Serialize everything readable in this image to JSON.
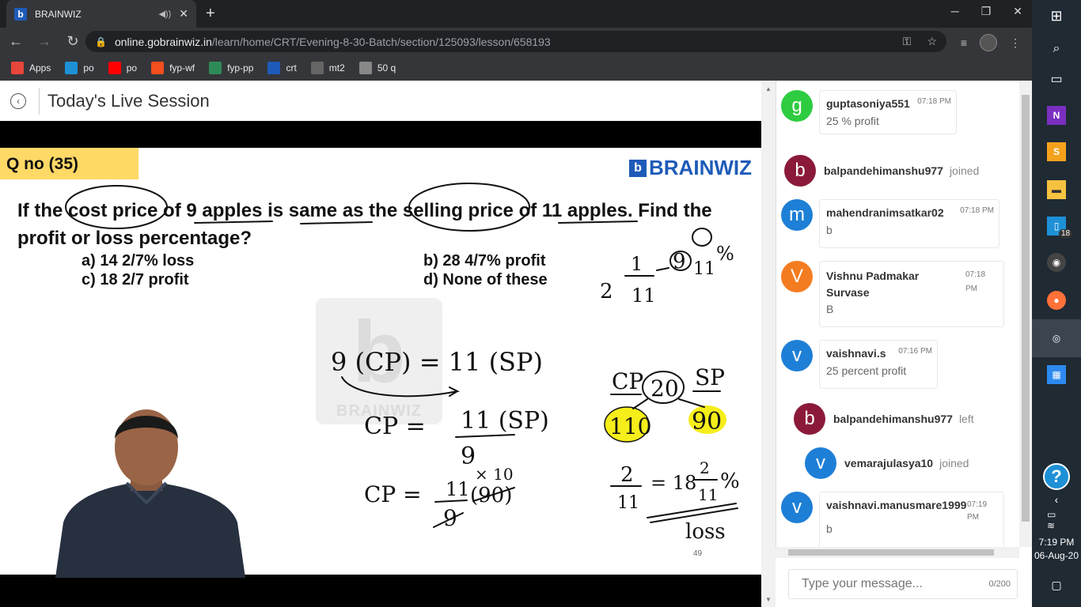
{
  "browser": {
    "tab_title": "BRAINWIZ",
    "url_host": "online.gobrainwiz.in",
    "url_path": "/learn/home/CRT/Evening-8-30-Batch/section/125093/lesson/658193",
    "bookmarks": [
      {
        "label": "Apps",
        "icon": "apps-grid-icon",
        "color": "#e8453c"
      },
      {
        "label": "po",
        "icon": "edge-icon",
        "color": "#1e90d6"
      },
      {
        "label": "po",
        "icon": "youtube-icon",
        "color": "#ff0000"
      },
      {
        "label": "fyp-wf",
        "icon": "figma-icon",
        "color": "#f24e1e"
      },
      {
        "label": "fyp-pp",
        "icon": "chart-icon",
        "color": "#2e8b57"
      },
      {
        "label": "crt",
        "icon": "brainwiz-icon",
        "color": "#1e5bb8"
      },
      {
        "label": "mt2",
        "icon": "cc-icon",
        "color": "#666666"
      },
      {
        "label": "50 q",
        "icon": "globe-icon",
        "color": "#888888"
      }
    ]
  },
  "page": {
    "title": "Today's Live Session"
  },
  "slide": {
    "qno": "Q no (35)",
    "brand": "BRAINWIZ",
    "question": "If the cost price of 9 apples is same as the selling price of 11 apples. Find the profit or loss percentage?",
    "options": {
      "a": "a)   14 2/7% loss",
      "b": "b) 28  4/7% profit",
      "c": "c)   18 2/7 profit",
      "d": "d) None of these"
    },
    "watermark": "BRAINWIZ",
    "page_number": "49"
  },
  "handwriting": {
    "eq1": "9 (CP) = 11 (SP)",
    "eq2_lhs": "CP  =",
    "eq2_num": "11 (SP)",
    "eq2_den": "9",
    "eq3_lhs": "CP  =",
    "eq3_num": "11",
    "eq3_den": "9",
    "eq3_mult": "× 10",
    "eq3_paren": "(90)",
    "cp_label": "CP",
    "sp_label": "SP",
    "diff": "20",
    "cp_val": "110",
    "sp_val": "90",
    "frac_top": "2",
    "frac_bot": "11",
    "result": "= 18",
    "result_frac_top": "2",
    "result_frac_bot": "11",
    "percent": "%",
    "loss": "loss",
    "top_note_2": "2",
    "top_note_1": "1",
    "top_note_11": "11",
    "top_note_9": "9",
    "top_note_pct": "%"
  },
  "chat": {
    "messages": [
      {
        "type": "msg",
        "initial": "g",
        "color": "#2ecc40",
        "user": "guptasoniya551",
        "time": "07:18 PM",
        "text": "25 % profit"
      },
      {
        "type": "event",
        "initial": "b",
        "color": "#8b1a3a",
        "user": "balpandehimanshu977",
        "state": "joined"
      },
      {
        "type": "msg",
        "initial": "m",
        "color": "#1e7fd6",
        "user": "mahendranimsatkar02",
        "time": "07:18 PM",
        "text": "b"
      },
      {
        "type": "msg",
        "initial": "V",
        "color": "#f47c20",
        "user": "Vishnu Padmakar Survase",
        "time": "07:18 PM",
        "text": "B"
      },
      {
        "type": "msg",
        "initial": "v",
        "color": "#1e7fd6",
        "user": "vaishnavi.s",
        "time": "07:16 PM",
        "text": "25 percent profit"
      },
      {
        "type": "event",
        "initial": "b",
        "color": "#8b1a3a",
        "user": "balpandehimanshu977",
        "state": "left"
      },
      {
        "type": "event",
        "initial": "v",
        "color": "#1e7fd6",
        "user": "vemarajulasya10",
        "state": "joined"
      },
      {
        "type": "msg",
        "initial": "v",
        "color": "#1e7fd6",
        "user": "vaishnavi.manusmare1999",
        "time": "07:19 PM",
        "text": "b"
      }
    ],
    "input_placeholder": "Type your message...",
    "char_count": "0/200"
  },
  "taskbar": {
    "badge": "18",
    "time": "7:19 PM",
    "date": "06-Aug-20",
    "help": "?"
  }
}
